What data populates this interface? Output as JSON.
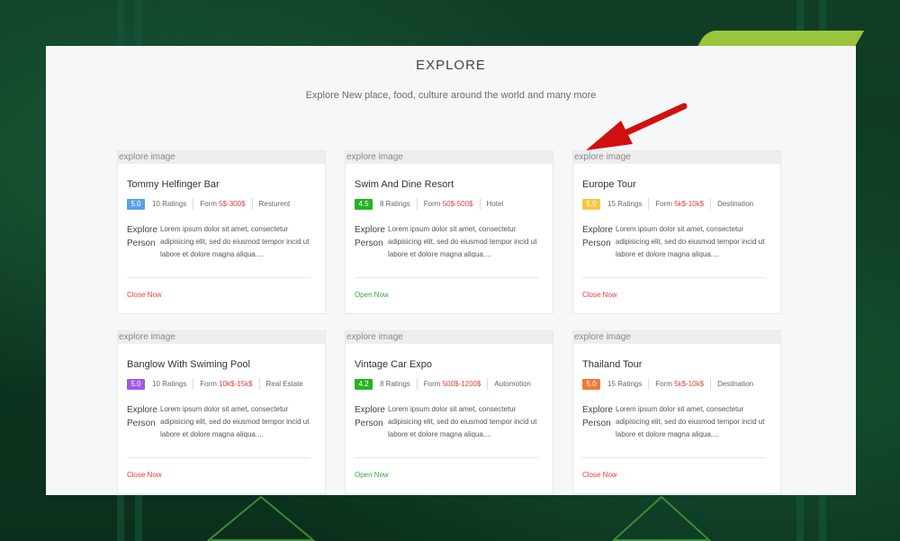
{
  "colors": {
    "page_bg": "#0f3b25",
    "panel_bg": "#f6f7f9",
    "price_red": "#e53d3d",
    "open_green": "#3aab3a",
    "arrow_red": "#d10f0f"
  },
  "header": {
    "title": "EXPLORE",
    "subtitle": "Explore New place, food, culture around the world and many more"
  },
  "cards": [
    {
      "image_alt": "explore image",
      "title": "Tommy Helfinger Bar",
      "rating": "5.0",
      "rating_color": "#5aa0e6",
      "ratings_count": "10 Ratings",
      "price_prefix": "Form",
      "price": "5$-300$",
      "category": "Resturent",
      "avatar_alt": "Explore Person",
      "description": "Lorem ipsum dolor sit amet, consectetur adipisicing elit, sed do eiusmod tempor incid ut labore et dolore magna aliqua....",
      "status": "Close Now"
    },
    {
      "image_alt": "explore image",
      "title": "Swim And Dine Resort",
      "rating": "4.5",
      "rating_color": "#22b522",
      "ratings_count": "8 Ratings",
      "price_prefix": "Form",
      "price": "50$-500$",
      "category": "Hotel",
      "avatar_alt": "Explore Person",
      "description": "Lorem ipsum dolor sit amet, consectetur adipisicing elit, sed do eiusmod tempor incid ut labore et dolore magna aliqua....",
      "status": "Open Now"
    },
    {
      "image_alt": "explore image",
      "title": "Europe Tour",
      "rating": "5.0",
      "rating_color": "#f5c842",
      "ratings_count": "15 Ratings",
      "price_prefix": "Form",
      "price": "5k$-10k$",
      "category": "Destination",
      "avatar_alt": "Explore Person",
      "description": "Lorem ipsum dolor sit amet, consectetur adipisicing elit, sed do eiusmod tempor incid ut labore et dolore magna aliqua....",
      "status": "Close Now"
    },
    {
      "image_alt": "explore image",
      "title": "Banglow With Swiming Pool",
      "rating": "5.0",
      "rating_color": "#a05ae6",
      "ratings_count": "10 Ratings",
      "price_prefix": "Form",
      "price": "10k$-15k$",
      "category": "Real Estate",
      "avatar_alt": "Explore Person",
      "description": "Lorem ipsum dolor sit amet, consectetur adipisicing elit, sed do eiusmod tempor incid ut labore et dolore magna aliqua....",
      "status": "Close Now"
    },
    {
      "image_alt": "explore image",
      "title": "Vintage Car Expo",
      "rating": "4.2",
      "rating_color": "#22b522",
      "ratings_count": "8 Ratings",
      "price_prefix": "Form",
      "price": "500$-1200$",
      "category": "Automotion",
      "avatar_alt": "Explore Person",
      "description": "Lorem ipsum dolor sit amet, consectetur adipisicing elit, sed do eiusmod tempor incid ut labore et dolore magna aliqua....",
      "status": "Open Now"
    },
    {
      "image_alt": "explore image",
      "title": "Thailand Tour",
      "rating": "5.0",
      "rating_color": "#f07a3a",
      "ratings_count": "15 Ratings",
      "price_prefix": "Form",
      "price": "5k$-10k$",
      "category": "Destination",
      "avatar_alt": "Explore Person",
      "description": "Lorem ipsum dolor sit amet, consectetur adipisicing elit, sed do eiusmod tempor incid ut labore et dolore magna aliqua....",
      "status": "Close Now"
    }
  ]
}
